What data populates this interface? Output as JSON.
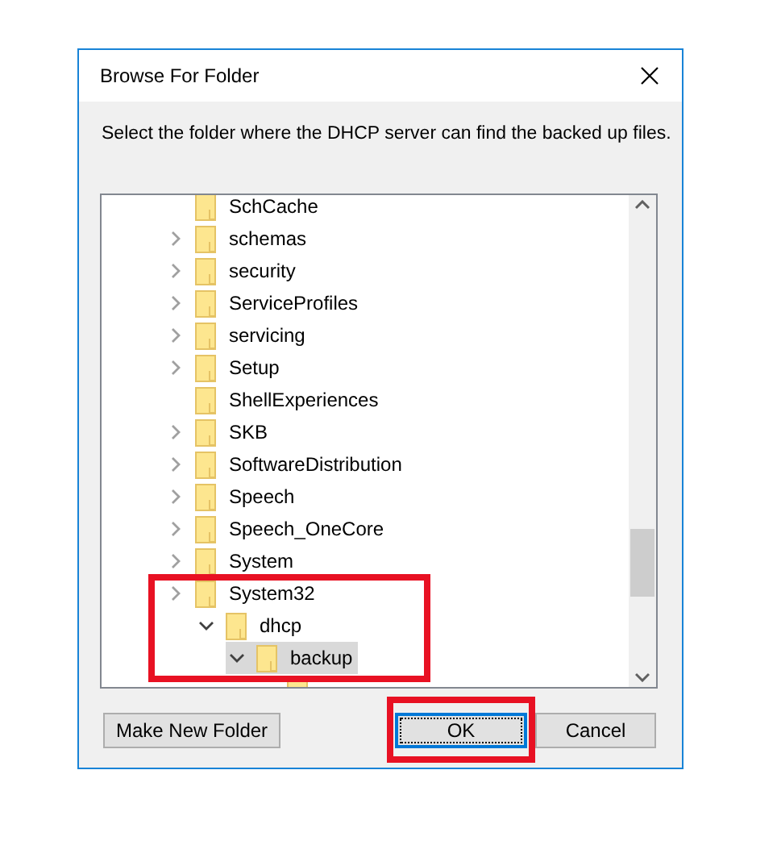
{
  "window": {
    "title": "Browse For Folder"
  },
  "instruction": "Select the folder where the DHCP server can find the backed up files.",
  "tree": [
    {
      "name": "SchCache",
      "expandable": false,
      "selected": false
    },
    {
      "name": "schemas",
      "expandable": true,
      "expanded": false,
      "selected": false
    },
    {
      "name": "security",
      "expandable": true,
      "expanded": false,
      "selected": false
    },
    {
      "name": "ServiceProfiles",
      "expandable": true,
      "expanded": false,
      "selected": false
    },
    {
      "name": "servicing",
      "expandable": true,
      "expanded": false,
      "selected": false
    },
    {
      "name": "Setup",
      "expandable": true,
      "expanded": false,
      "selected": false
    },
    {
      "name": "ShellExperiences",
      "expandable": false,
      "selected": false
    },
    {
      "name": "SKB",
      "expandable": true,
      "expanded": false,
      "selected": false
    },
    {
      "name": "SoftwareDistribution",
      "expandable": true,
      "expanded": false,
      "selected": false
    },
    {
      "name": "Speech",
      "expandable": true,
      "expanded": false,
      "selected": false
    },
    {
      "name": "Speech_OneCore",
      "expandable": true,
      "expanded": false,
      "selected": false
    },
    {
      "name": "System",
      "expandable": true,
      "expanded": false,
      "selected": false
    },
    {
      "name": "System32",
      "expandable": true,
      "expanded": false,
      "selected": false,
      "highlighted": true,
      "children": [
        {
          "name": "dhcp",
          "expandable": true,
          "expanded": true,
          "selected": false,
          "children": [
            {
              "name": "backup",
              "expandable": true,
              "expanded": true,
              "selected": true,
              "children": [
                {
                  "selected": false
                }
              ]
            }
          ]
        }
      ]
    }
  ],
  "buttons": [
    {
      "label": "Make New Folder",
      "default": false,
      "highlighted": false
    },
    {
      "label": "OK",
      "default": true,
      "highlighted": true
    },
    {
      "label": "Cancel",
      "default": false,
      "highlighted": false
    }
  ]
}
